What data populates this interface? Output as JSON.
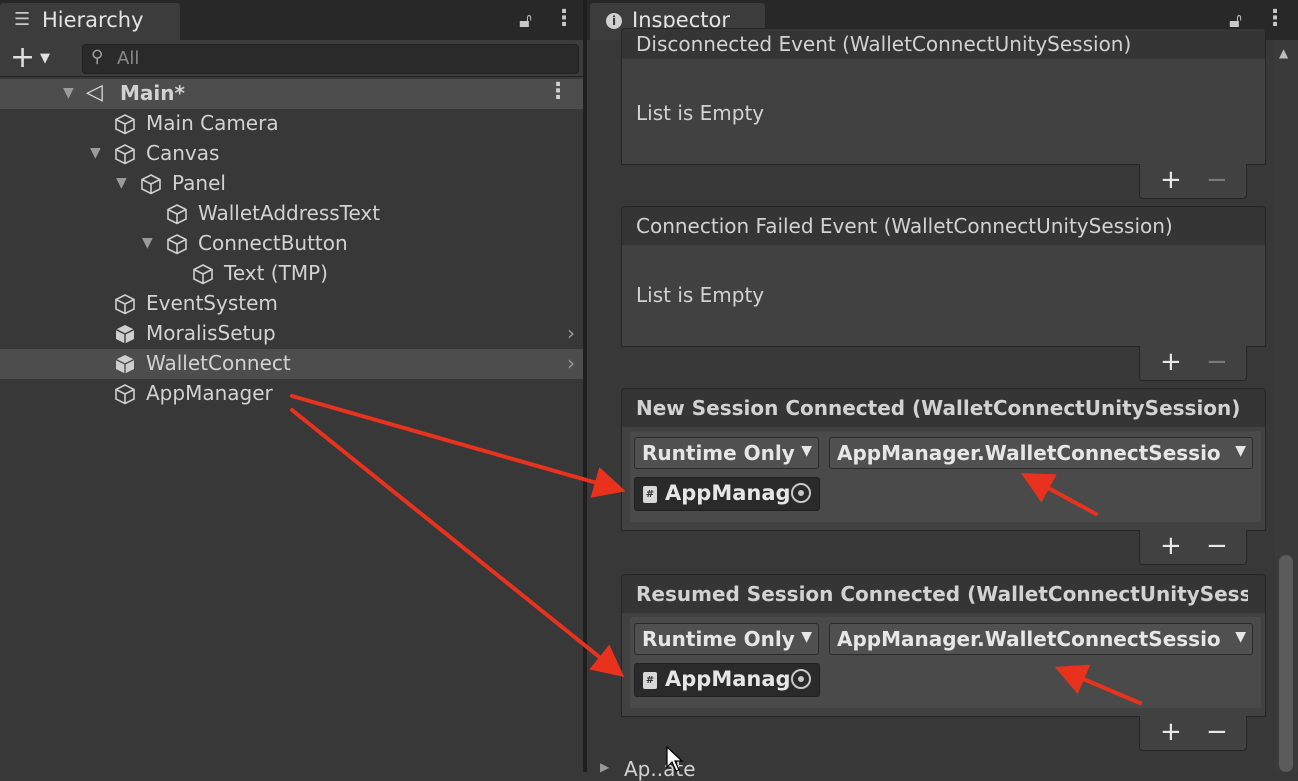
{
  "hierarchy": {
    "tab_label": "Hierarchy",
    "search_placeholder": "All",
    "scene_name": "Main*",
    "items": [
      {
        "label": "Main Camera"
      },
      {
        "label": "Canvas"
      },
      {
        "label": "Panel"
      },
      {
        "label": "WalletAddressText"
      },
      {
        "label": "ConnectButton"
      },
      {
        "label": "Text (TMP)"
      },
      {
        "label": "EventSystem"
      },
      {
        "label": "MoralisSetup"
      },
      {
        "label": "WalletConnect"
      },
      {
        "label": "AppManager"
      }
    ]
  },
  "inspector": {
    "tab_label": "Inspector",
    "events": [
      {
        "title": "Disconnected Event (WalletConnectUnitySession)",
        "empty_text": "List is Empty"
      },
      {
        "title": "Connection Failed Event (WalletConnectUnitySession)",
        "empty_text": "List is Empty"
      },
      {
        "title": "New Session Connected (WalletConnectUnitySession)",
        "mode": "Runtime Only",
        "function": "AppManager.WalletConnectSessio",
        "object": "AppManag"
      },
      {
        "title": "Resumed Session Connected (WalletConnectUnitySess",
        "mode": "Runtime Only",
        "function": "AppManager.WalletConnectSessio",
        "object": "AppManag"
      }
    ],
    "footer_partial": "Ap..ate"
  },
  "annotation_color": "#e8321e"
}
